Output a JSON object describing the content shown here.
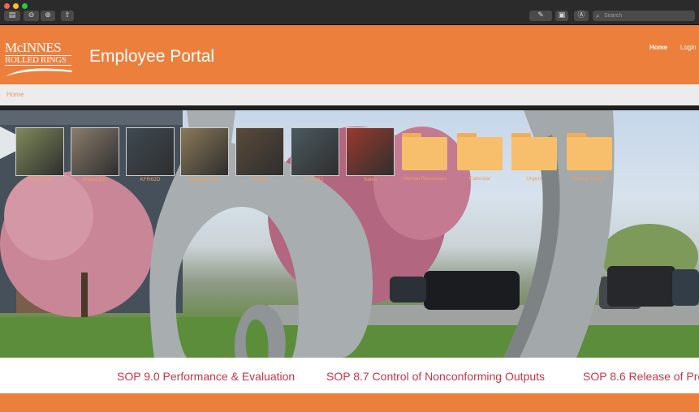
{
  "toolbar": {
    "search_placeholder": "Search"
  },
  "header": {
    "logo": {
      "line1": "McINNES",
      "line2": "ROLLED RINGS"
    },
    "title": "Employee Portal",
    "nav": {
      "home": "Home",
      "login": "Login"
    }
  },
  "breadcrumb": {
    "home": "Home"
  },
  "tiles": [
    {
      "label": "Heat Treat",
      "kind": "photo",
      "color": "#7f8a5a"
    },
    {
      "label": "Inspection",
      "kind": "photo",
      "color": "#8a7d6c"
    },
    {
      "label": "KFR62D",
      "kind": "photo",
      "color": "#3f4a52"
    },
    {
      "label": "Maintenance",
      "kind": "photo",
      "color": "#8b7a5a"
    },
    {
      "label": "Row63",
      "kind": "photo",
      "color": "#5a4a3a"
    },
    {
      "label": "Row83",
      "kind": "photo",
      "color": "#4b5a5f"
    },
    {
      "label": "Sales",
      "kind": "photo",
      "color": "#9a3a2e"
    },
    {
      "label": "Human Resources",
      "kind": "folder"
    },
    {
      "label": "Calendar",
      "kind": "folder"
    },
    {
      "label": "Urgent",
      "kind": "folder"
    },
    {
      "label": "Global Search",
      "kind": "folder"
    }
  ],
  "sop_ticker": [
    "SOP 9.0 Performance & Evaluation",
    "SOP 8.7 Control of Nonconforming Outputs",
    "SOP 8.6 Release of Pro"
  ]
}
